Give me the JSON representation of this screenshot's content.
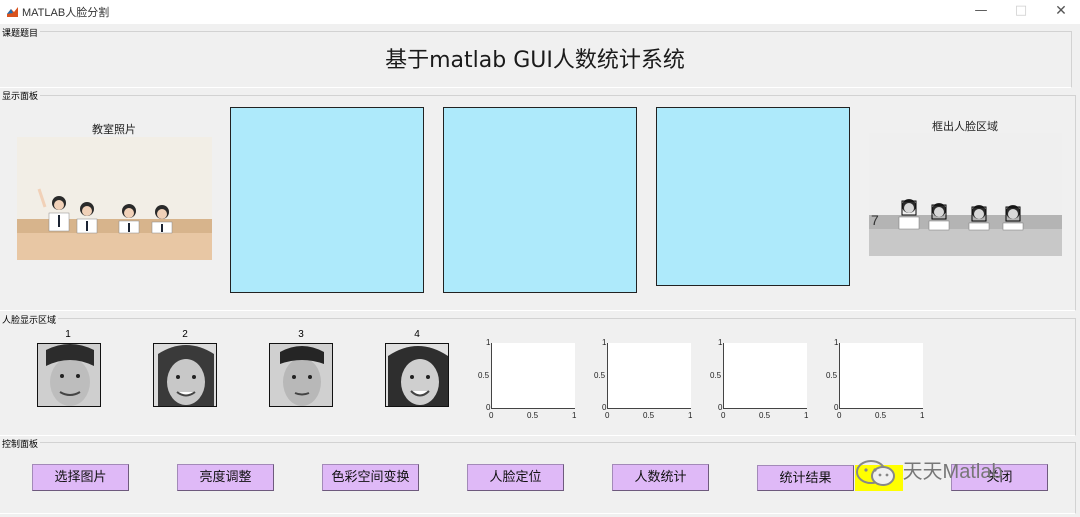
{
  "window": {
    "title": "MATLAB人脸分割",
    "min_icon": "—",
    "max_icon": "□",
    "close_icon": "✕"
  },
  "panels": {
    "topic": "课题题目",
    "display": "显示面板",
    "faces": "人脸显示区域",
    "control": "控制面板"
  },
  "main_title": "基于matlab GUI人数统计系统",
  "display": {
    "left_caption": "教室照片",
    "right_caption": "框出人脸区域",
    "axes_color": "#aeeafb"
  },
  "faces": {
    "labels": [
      "1",
      "2",
      "3",
      "4"
    ]
  },
  "mini_plot_ticks": {
    "y": [
      "1",
      "0.5",
      "0"
    ],
    "x": [
      "0",
      "0.5",
      "1"
    ]
  },
  "buttons": [
    "选择图片",
    "亮度调整",
    "色彩空间变换",
    "人脸定位",
    "人数统计",
    "统计结果",
    "关闭"
  ],
  "button_color": "#dfb9f7",
  "watermark": "天天Matlab"
}
